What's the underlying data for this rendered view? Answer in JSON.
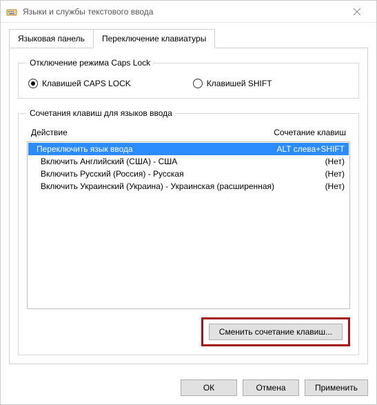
{
  "window": {
    "title": "Языки и службы текстового ввода"
  },
  "tabs": {
    "language_bar": "Языковая панель",
    "keyboard_switch": "Переключение клавиатуры"
  },
  "capslock_group": {
    "legend": "Отключение режима Caps Lock",
    "option_caps": "Клавишей CAPS LOCK",
    "option_shift": "Клавишей SHIFT"
  },
  "hotkeys_group": {
    "legend": "Сочетания клавиш для языков ввода",
    "header_action": "Действие",
    "header_shortcut": "Сочетание клавиш",
    "rows": [
      {
        "action": "Переключить язык ввода",
        "shortcut": "ALT слева+SHIFT",
        "selected": true
      },
      {
        "action": "Включить Английский (США) - США",
        "shortcut": "(Нет)",
        "selected": false
      },
      {
        "action": "Включить Русский (Россия) - Русская",
        "shortcut": "(Нет)",
        "selected": false
      },
      {
        "action": "Включить Украинский (Украина) - Украинская (расширенная)",
        "shortcut": "(Нет)",
        "selected": false
      }
    ],
    "change_button": "Сменить сочетание клавиш..."
  },
  "footer": {
    "ok": "ОК",
    "cancel": "Отмена",
    "apply": "Применить"
  }
}
